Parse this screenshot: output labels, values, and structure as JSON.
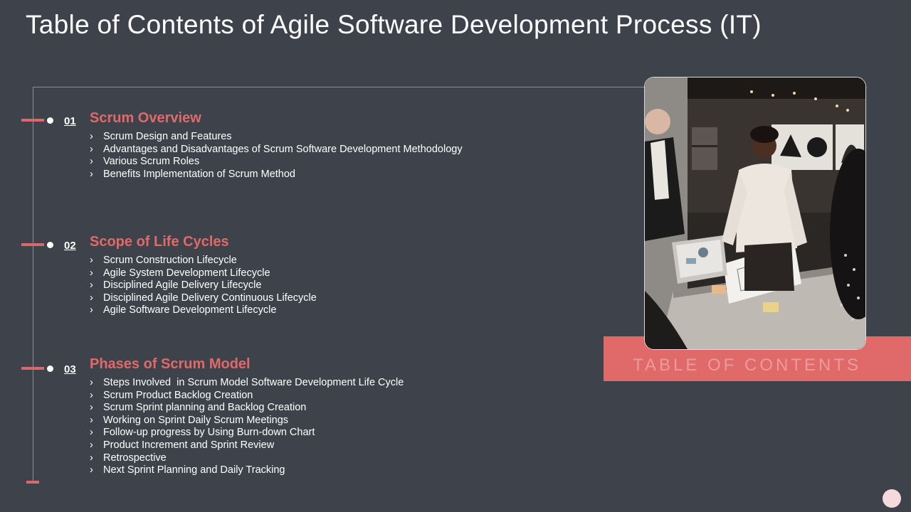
{
  "title": "Table of Contents of Agile Software Development Process (IT)",
  "chevron": "›",
  "sections": [
    {
      "number": "01",
      "title": "Scrum Overview",
      "items": [
        "Scrum Design and Features",
        "Advantages and Disadvantages of Scrum Software Development Methodology",
        "Various Scrum Roles",
        "Benefits Implementation of Scrum Method"
      ]
    },
    {
      "number": "02",
      "title": "Scope of Life Cycles",
      "items": [
        "Scrum Construction Lifecycle",
        "Agile System Development Lifecycle",
        "Disciplined Agile Delivery Lifecycle",
        "Disciplined Agile Delivery Continuous Lifecycle",
        "Agile Software Development Lifecycle"
      ]
    },
    {
      "number": "03",
      "title": "Phases of Scrum Model",
      "items": [
        "Steps Involved  in Scrum Model Software Development Life Cycle",
        "Scrum Product Backlog Creation",
        "Scrum Sprint planning and Backlog Creation",
        "Working on Sprint Daily Scrum Meetings",
        "Follow-up progress by Using Burn-down Chart",
        "Product Increment and Sprint Review",
        "Retrospective",
        "Next Sprint Planning and Daily Tracking"
      ]
    }
  ],
  "side_label": "TABLE OF CONTENTS",
  "colors": {
    "background": "#3e434b",
    "accent": "#e06a6a",
    "accent_light": "#f6d9dc"
  }
}
